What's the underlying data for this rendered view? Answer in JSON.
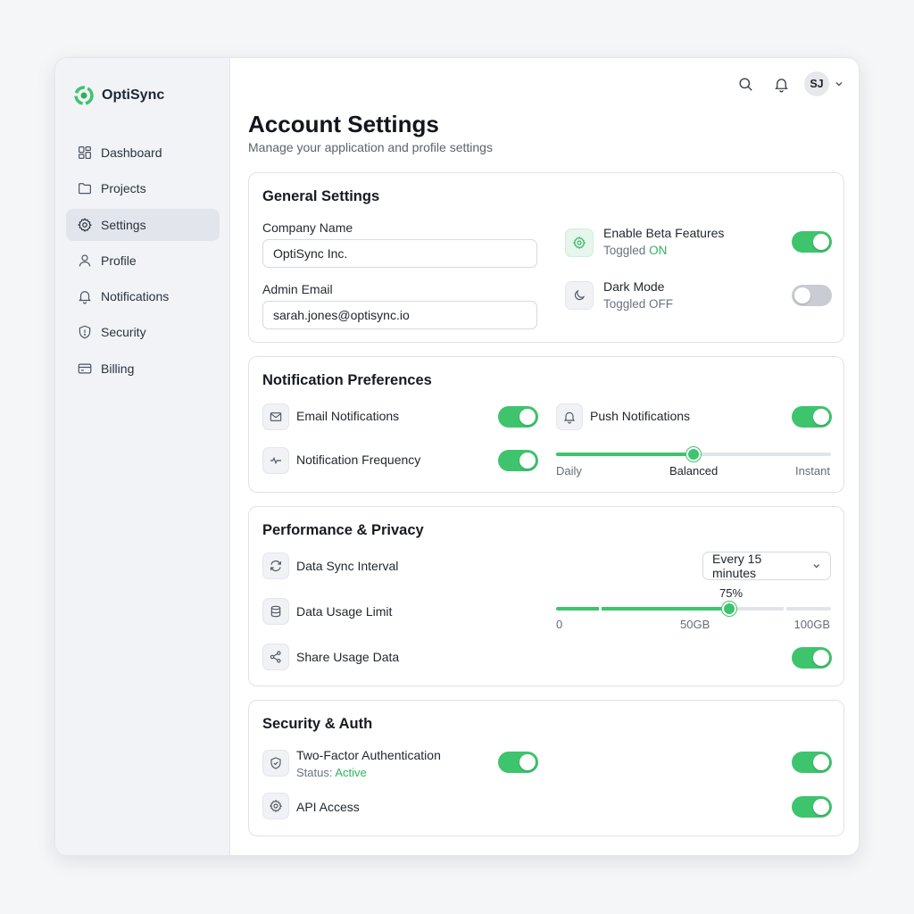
{
  "brand": {
    "name": "OptiSync"
  },
  "nav": [
    {
      "label": "Dashboard",
      "icon": "grid-icon"
    },
    {
      "label": "Projects",
      "icon": "folder-icon"
    },
    {
      "label": "Settings",
      "icon": "gear-icon",
      "active": true
    },
    {
      "label": "Profile",
      "icon": "user-icon"
    },
    {
      "label": "Notifications",
      "icon": "bell-icon"
    },
    {
      "label": "Security",
      "icon": "shield-icon"
    },
    {
      "label": "Billing",
      "icon": "credit-card-icon"
    }
  ],
  "header": {
    "avatar_initials": "SJ"
  },
  "page": {
    "title": "Account Settings",
    "subtitle": "Manage your application and profile settings"
  },
  "general": {
    "title": "General Settings",
    "company_label": "Company Name",
    "company_value": "OptiSync Inc.",
    "email_label": "Admin Email",
    "email_value": "sarah.jones@optisync.io",
    "beta_label": "Enable Beta Features",
    "beta_status_prefix": "Toggled",
    "beta_status_value": "ON",
    "beta_on": true,
    "dark_label": "Dark Mode",
    "dark_status": "Toggled OFF",
    "dark_on": false
  },
  "notifications": {
    "title": "Notification Preferences",
    "email_label": "Email Notifications",
    "email_on": true,
    "push_label": "Push Notifications",
    "push_on": true,
    "frequency_label": "Notification Frequency",
    "frequency_on": true,
    "frequency_slider": {
      "labels": [
        "Daily",
        "Balanced",
        "Instant"
      ],
      "value_fraction": 0.5,
      "selected": "Balanced"
    }
  },
  "performance": {
    "title": "Performance & Privacy",
    "sync_label": "Data Sync Interval",
    "sync_value": "Every 15 minutes",
    "usage_label": "Data Usage Limit",
    "usage_slider": {
      "value_label": "75%",
      "value_fraction": 0.63,
      "min_label": "0",
      "mid_label": "50GB",
      "max_label": "100GB"
    },
    "share_label": "Share Usage Data",
    "share_on": true
  },
  "security": {
    "title": "Security & Auth",
    "twofa_label": "Two-Factor Authentication",
    "twofa_status_prefix": "Status:",
    "twofa_status_value": "Active",
    "twofa_on": true,
    "twofa_right_on": true,
    "api_label": "API Access",
    "api_on": true
  },
  "colors": {
    "accent": "#3ec46d",
    "accent_text": "#2fb35d",
    "toggle_off": "#c9ccd2"
  }
}
